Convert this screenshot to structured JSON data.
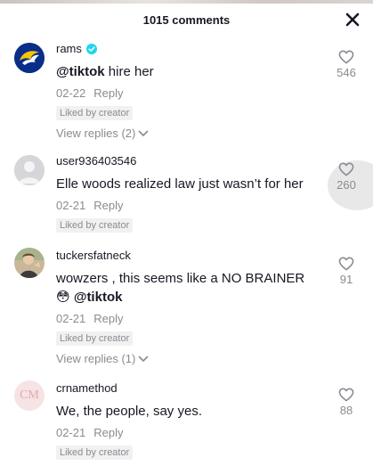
{
  "header": {
    "title": "1015 comments"
  },
  "colors": {
    "accent_blue": "#20d5ec",
    "muted": "#8a8b91",
    "text": "#161823"
  },
  "comments": [
    {
      "username": "rams",
      "verified": true,
      "mention": "@tiktok",
      "text_after": " hire her",
      "date": "02-22",
      "reply_label": "Reply",
      "liked_badge": "Liked by creator",
      "likes": "546",
      "view_replies": "View replies (2)",
      "avatar_icon": "rams-logo-icon"
    },
    {
      "username": "user936403546",
      "verified": false,
      "text": "Elle woods realized law just wasn’t for her",
      "date": "02-21",
      "reply_label": "Reply",
      "liked_badge": "Liked by creator",
      "likes": "260",
      "avatar_icon": "default-avatar-icon"
    },
    {
      "username": "tuckersfatneck",
      "verified": false,
      "text_line1": "wowzers , this seems like a NO BRAINER",
      "emoji": "😳",
      "mention": "@tiktok",
      "date": "02-21",
      "reply_label": "Reply",
      "liked_badge": "Liked by creator",
      "likes": "91",
      "view_replies": "View replies (1)",
      "avatar_icon": "photo-avatar-icon"
    },
    {
      "username": "crnamethod",
      "verified": false,
      "text": "We, the people, say yes.",
      "date": "02-21",
      "reply_label": "Reply",
      "liked_badge": "Liked by creator",
      "likes": "88",
      "avatar_text": "CM",
      "avatar_icon": "monogram-avatar-icon"
    }
  ]
}
